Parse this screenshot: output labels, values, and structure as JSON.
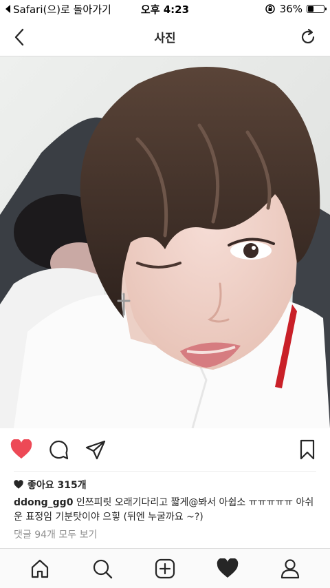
{
  "status": {
    "back_app": "Safari(으)로 돌아가기",
    "time": "오후 4:23",
    "battery": "36%",
    "battery_level": 0.36
  },
  "nav": {
    "title": "사진"
  },
  "post": {
    "likes": "좋아요 315개",
    "username": "ddong_gg0",
    "caption": "인쯔피릿 오래기다리고 짧게@봐서 아쉽소  ㅠㅠㅠㅠㅠ 아쉬운 표정임 기분탓이야 으힣 (뒤엔 누굴까요 ~?)",
    "comments_link": "댓글 94개 모두 보기",
    "liked": true
  },
  "colors": {
    "like_red": "#ed4956",
    "text": "#262626",
    "muted": "#8e8e8e"
  },
  "icons": {
    "actions": [
      "heart-icon",
      "comment-icon",
      "share-icon",
      "bookmark-icon"
    ],
    "tabs": [
      "home-icon",
      "search-icon",
      "add-icon",
      "activity-icon",
      "profile-icon"
    ]
  }
}
